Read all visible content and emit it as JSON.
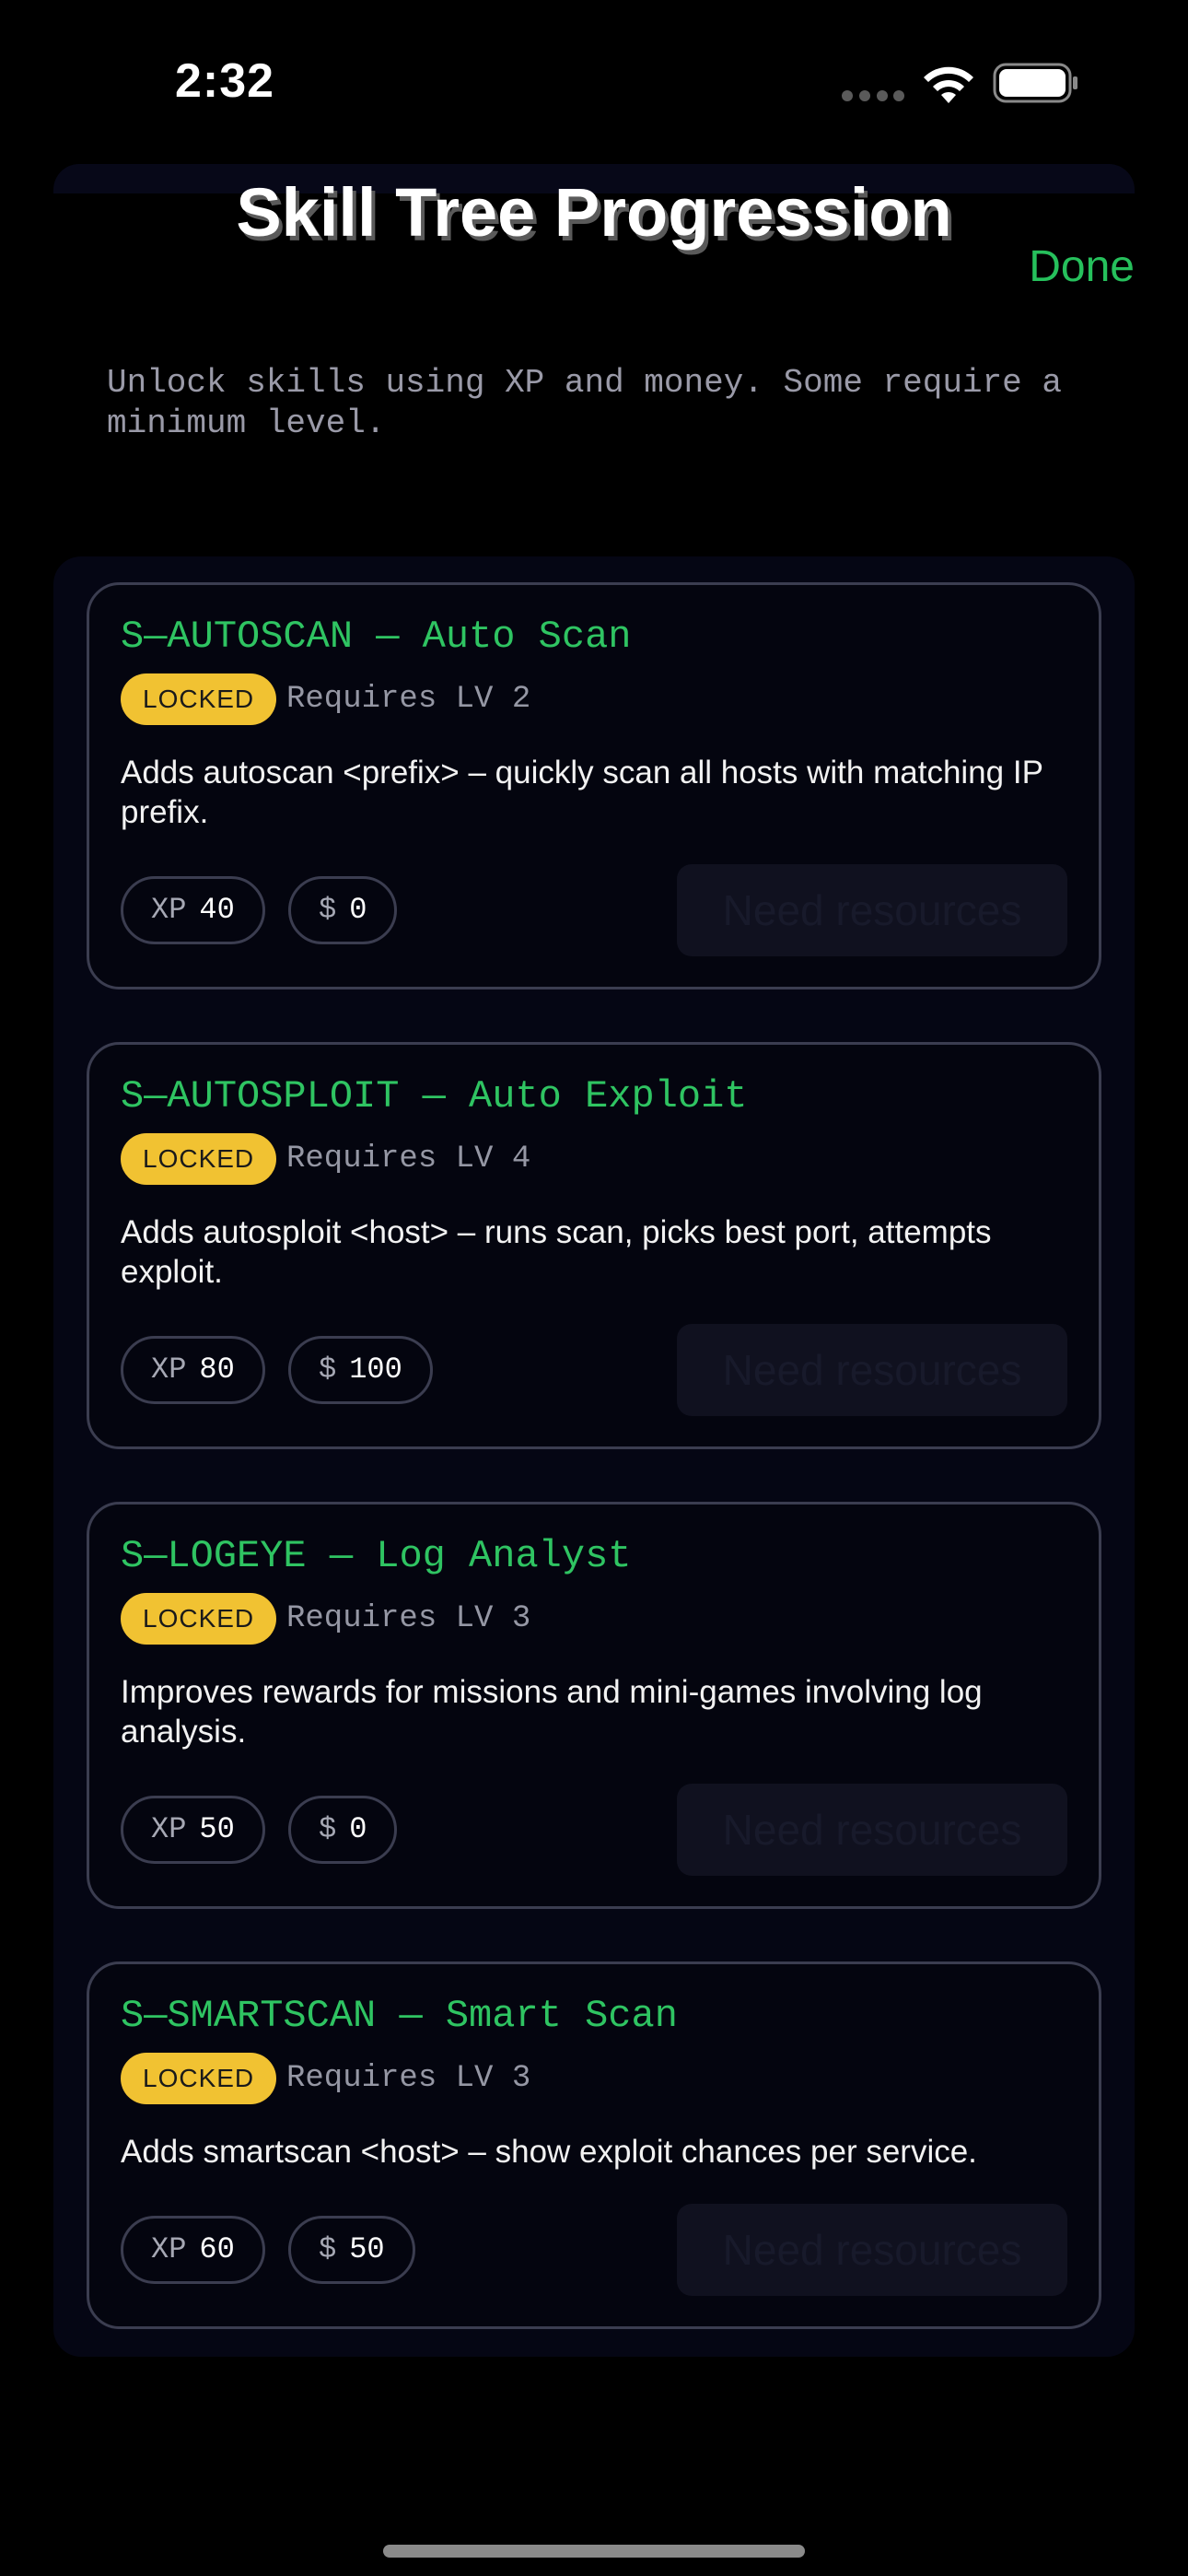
{
  "status_bar": {
    "time": "2:32"
  },
  "header": {
    "title": "Skill Tree Progression",
    "done_label": "Done"
  },
  "subtitle": "Unlock skills using XP and money. Some require a minimum level.",
  "colors": {
    "accent_green": "#2fc462",
    "badge_yellow": "#f1c232",
    "background": "#000000",
    "panel": "#050614"
  },
  "skills": [
    {
      "title": "S—AUTOSCAN — Auto Scan",
      "status": "LOCKED",
      "requirement": "Requires LV 2",
      "description": "Adds autoscan <prefix> – quickly scan all hosts with matching IP prefix.",
      "xp_label": "XP",
      "xp_value": "40",
      "money_label": "$",
      "money_value": "0",
      "action_label": "Need resources"
    },
    {
      "title": "S—AUTOSPLOIT — Auto Exploit",
      "status": "LOCKED",
      "requirement": "Requires LV 4",
      "description": "Adds autosploit <host> – runs scan, picks best port, attempts exploit.",
      "xp_label": "XP",
      "xp_value": "80",
      "money_label": "$",
      "money_value": "100",
      "action_label": "Need resources"
    },
    {
      "title": "S—LOGEYE — Log Analyst",
      "status": "LOCKED",
      "requirement": "Requires LV 3",
      "description": "Improves rewards for missions and mini-games involving log analysis.",
      "xp_label": "XP",
      "xp_value": "50",
      "money_label": "$",
      "money_value": "0",
      "action_label": "Need resources"
    },
    {
      "title": "S—SMARTSCAN — Smart Scan",
      "status": "LOCKED",
      "requirement": "Requires LV 3",
      "description": "Adds smartscan <host> – show exploit chances per service.",
      "xp_label": "XP",
      "xp_value": "60",
      "money_label": "$",
      "money_value": "50",
      "action_label": "Need resources"
    }
  ]
}
